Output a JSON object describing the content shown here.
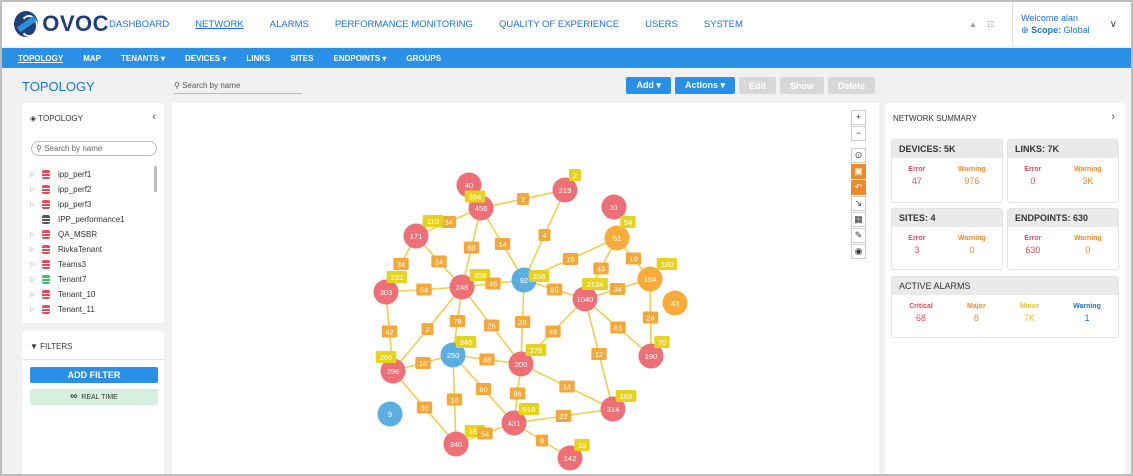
{
  "brand": {
    "name": "OVOC"
  },
  "top_nav": [
    "DASHBOARD",
    "NETWORK",
    "ALARMS",
    "PERFORMANCE MONITORING",
    "QUALITY OF EXPERIENCE",
    "USERS",
    "SYSTEM"
  ],
  "top_nav_active": "NETWORK",
  "user": {
    "welcome": "Welcome",
    "name": "alan",
    "scope_label": "Scope:",
    "scope_value": "Global"
  },
  "sub_nav": [
    "TOPOLOGY",
    "MAP",
    "TENANTS ▾",
    "DEVICES ▾",
    "LINKS",
    "SITES",
    "ENDPOINTS ▾",
    "GROUPS"
  ],
  "page": {
    "title": "TOPOLOGY",
    "search_placeholder": "Search by name",
    "buttons": {
      "add": "Add ▾",
      "actions": "Actions ▾",
      "edit": "Edit",
      "show": "Show",
      "delete": "Delete"
    }
  },
  "left_panel": {
    "title": "TOPOLOGY",
    "search_placeholder": "Search by name",
    "tree": [
      {
        "label": "ipp_perf1",
        "color": "#e94b56",
        "expandable": true
      },
      {
        "label": "ipp_perf2",
        "color": "#e94b56",
        "expandable": true
      },
      {
        "label": "ipp_perf3",
        "color": "#e94b56",
        "expandable": true
      },
      {
        "label": "IPP_performance1",
        "color": "#555555",
        "expandable": false
      },
      {
        "label": "QA_MSBR",
        "color": "#e94b56",
        "expandable": true
      },
      {
        "label": "RivkaTenant",
        "color": "#e94b56",
        "expandable": true
      },
      {
        "label": "Teams3",
        "color": "#e94b56",
        "expandable": true
      },
      {
        "label": "Tenant7",
        "color": "#3bbf6a",
        "expandable": true
      },
      {
        "label": "Tenant_10",
        "color": "#e94b56",
        "expandable": true
      },
      {
        "label": "Tenant_11",
        "color": "#e94b56",
        "expandable": true
      }
    ]
  },
  "filters": {
    "title": "FILTERS",
    "add_filter": "ADD FILTER",
    "real_time": "REAL TIME"
  },
  "right_panel": {
    "title": "NETWORK SUMMARY",
    "devices": {
      "title": "DEVICES:",
      "count": "5K",
      "error_label": "Error",
      "error": "47",
      "warning_label": "Warning",
      "warning": "976"
    },
    "links": {
      "title": "LINKS:",
      "count": "7K",
      "error_label": "Error",
      "error": "0",
      "warning_label": "Warning",
      "warning": "3K"
    },
    "sites": {
      "title": "SITES:",
      "count": "4",
      "error_label": "Error",
      "error": "3",
      "warning_label": "Warning",
      "warning": "0"
    },
    "endpoints": {
      "title": "ENDPOINTS:",
      "count": "630",
      "error_label": "Error",
      "error": "630",
      "warning_label": "Warning",
      "warning": "0"
    },
    "alarms": {
      "title": "ACTIVE ALARMS",
      "critical_label": "Critical",
      "critical": "68",
      "major_label": "Major",
      "major": "8",
      "minor_label": "Minor",
      "minor": "7K",
      "warning_label": "Warning",
      "warning": "1"
    }
  },
  "colors": {
    "accent": "#2a8fe6",
    "node_red": "#ee6f76",
    "node_blue": "#5aaee3",
    "node_orange": "#f7ac3a",
    "link_yellow": "#f5cd4c",
    "label_orange": "#f4a83a",
    "label_yellow": "#e7d31d"
  },
  "topology": {
    "nodes": [
      {
        "id": "n40",
        "label": "40",
        "color": "red"
      },
      {
        "id": "n456",
        "label": "456",
        "color": "red"
      },
      {
        "id": "n219",
        "label": "219",
        "color": "red"
      },
      {
        "id": "n31",
        "label": "31",
        "color": "red"
      },
      {
        "id": "n51",
        "label": "51",
        "color": "orange"
      },
      {
        "id": "n171",
        "label": "171",
        "color": "red"
      },
      {
        "id": "n92",
        "label": "92",
        "color": "blue"
      },
      {
        "id": "n154",
        "label": "154",
        "color": "orange"
      },
      {
        "id": "n303",
        "label": "303",
        "color": "red"
      },
      {
        "id": "n248",
        "label": "248",
        "color": "red"
      },
      {
        "id": "n1040",
        "label": "1040",
        "color": "red"
      },
      {
        "id": "n43",
        "label": "43",
        "color": "orange"
      },
      {
        "id": "n250",
        "label": "250",
        "color": "blue"
      },
      {
        "id": "n296",
        "label": "296",
        "color": "red"
      },
      {
        "id": "n200",
        "label": "200",
        "color": "red"
      },
      {
        "id": "n190",
        "label": "190",
        "color": "red"
      },
      {
        "id": "n9",
        "label": "9",
        "color": "blue"
      },
      {
        "id": "n431",
        "label": "431",
        "color": "red"
      },
      {
        "id": "n314",
        "label": "314",
        "color": "red"
      },
      {
        "id": "n340",
        "label": "340",
        "color": "red"
      },
      {
        "id": "n142",
        "label": "142",
        "color": "red"
      }
    ],
    "links": [
      {
        "a": "n456",
        "b": "n40",
        "label": "394",
        "color": "yellow"
      },
      {
        "a": "n456",
        "b": "n219",
        "label": "2",
        "color": "orange"
      },
      {
        "a": "n219",
        "b": "n219",
        "label": "2",
        "color": "yellow"
      },
      {
        "a": "n456",
        "b": "n171",
        "label": "34",
        "color": "orange"
      },
      {
        "a": "n171",
        "b": "n171",
        "label": "110",
        "color": "yellow"
      },
      {
        "a": "n456",
        "b": "n248",
        "label": "60",
        "color": "orange"
      },
      {
        "a": "n456",
        "b": "n92",
        "label": "14",
        "color": "orange"
      },
      {
        "a": "n219",
        "b": "n92",
        "label": "4",
        "color": "orange"
      },
      {
        "a": "n171",
        "b": "n303",
        "label": "34",
        "color": "orange"
      },
      {
        "a": "n171",
        "b": "n248",
        "label": "24",
        "color": "orange"
      },
      {
        "a": "n303",
        "b": "n303",
        "label": "232",
        "color": "yellow"
      },
      {
        "a": "n303",
        "b": "n248",
        "label": "54",
        "color": "orange"
      },
      {
        "a": "n248",
        "b": "n248",
        "label": "358",
        "color": "yellow"
      },
      {
        "a": "n248",
        "b": "n92",
        "label": "46",
        "color": "orange"
      },
      {
        "a": "n92",
        "b": "n92",
        "label": "106",
        "color": "yellow"
      },
      {
        "a": "n92",
        "b": "n51",
        "label": "16",
        "color": "orange"
      },
      {
        "a": "n51",
        "b": "n51",
        "label": "54",
        "color": "yellow"
      },
      {
        "a": "n51",
        "b": "n154",
        "label": "10",
        "color": "orange"
      },
      {
        "a": "n154",
        "b": "n154",
        "label": "180",
        "color": "yellow"
      },
      {
        "a": "n92",
        "b": "n1040",
        "label": "85",
        "color": "orange"
      },
      {
        "a": "n51",
        "b": "n1040",
        "label": "43",
        "color": "orange"
      },
      {
        "a": "n1040",
        "b": "n1040",
        "label": "2134",
        "color": "yellow"
      },
      {
        "a": "n1040",
        "b": "n154",
        "label": "34",
        "color": "orange"
      },
      {
        "a": "n154",
        "b": "n190",
        "label": "24",
        "color": "orange"
      },
      {
        "a": "n190",
        "b": "n190",
        "label": "70",
        "color": "yellow"
      },
      {
        "a": "n1040",
        "b": "n190",
        "label": "61",
        "color": "orange"
      },
      {
        "a": "n1040",
        "b": "n200",
        "label": "48",
        "color": "orange"
      },
      {
        "a": "n1040",
        "b": "n314",
        "label": "12",
        "color": "orange"
      },
      {
        "a": "n303",
        "b": "n296",
        "label": "42",
        "color": "orange"
      },
      {
        "a": "n248",
        "b": "n296",
        "label": "2",
        "color": "orange"
      },
      {
        "a": "n248",
        "b": "n250",
        "label": "78",
        "color": "orange"
      },
      {
        "a": "n250",
        "b": "n250",
        "label": "346",
        "color": "yellow"
      },
      {
        "a": "n248",
        "b": "n200",
        "label": "26",
        "color": "orange"
      },
      {
        "a": "n92",
        "b": "n200",
        "label": "26",
        "color": "orange"
      },
      {
        "a": "n296",
        "b": "n250",
        "label": "16",
        "color": "orange"
      },
      {
        "a": "n296",
        "b": "n296",
        "label": "266",
        "color": "yellow"
      },
      {
        "a": "n250",
        "b": "n200",
        "label": "48",
        "color": "orange"
      },
      {
        "a": "n200",
        "b": "n200",
        "label": "276",
        "color": "yellow"
      },
      {
        "a": "n250",
        "b": "n431",
        "label": "60",
        "color": "orange"
      },
      {
        "a": "n200",
        "b": "n431",
        "label": "86",
        "color": "orange"
      },
      {
        "a": "n431",
        "b": "n431",
        "label": "618",
        "color": "yellow"
      },
      {
        "a": "n200",
        "b": "n314",
        "label": "14",
        "color": "orange"
      },
      {
        "a": "n314",
        "b": "n314",
        "label": "168",
        "color": "yellow"
      },
      {
        "a": "n431",
        "b": "n314",
        "label": "22",
        "color": "orange"
      },
      {
        "a": "n296",
        "b": "n340",
        "label": "30",
        "color": "orange"
      },
      {
        "a": "n250",
        "b": "n340",
        "label": "18",
        "color": "orange"
      },
      {
        "a": "n340",
        "b": "n340",
        "label": "180",
        "color": "yellow"
      },
      {
        "a": "n431",
        "b": "n340",
        "label": "54",
        "color": "orange"
      },
      {
        "a": "n431",
        "b": "n142",
        "label": "8",
        "color": "orange"
      },
      {
        "a": "n142",
        "b": "n142",
        "label": "10",
        "color": "yellow"
      }
    ]
  }
}
